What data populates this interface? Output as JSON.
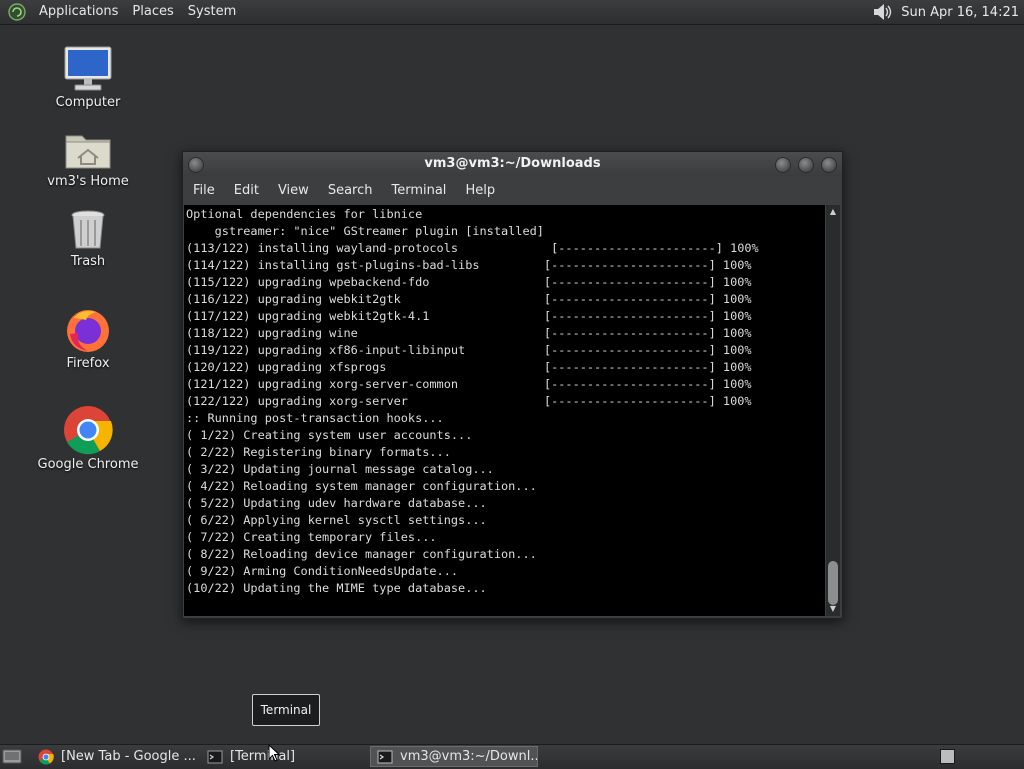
{
  "top_panel": {
    "menus": [
      "Applications",
      "Places",
      "System"
    ],
    "clock": "Sun Apr 16, 14:21",
    "icons": [
      "distro-logo-icon",
      "speaker-icon"
    ]
  },
  "desktop": {
    "icons": [
      {
        "label": "Computer",
        "icon": "computer-icon"
      },
      {
        "label": "vm3's Home",
        "icon": "home-folder-icon"
      },
      {
        "label": "Trash",
        "icon": "trash-icon"
      },
      {
        "label": "Firefox",
        "icon": "firefox-icon"
      },
      {
        "label": "Google Chrome",
        "icon": "chrome-icon"
      }
    ]
  },
  "window": {
    "title": "vm3@vm3:~/Downloads",
    "menu": [
      "File",
      "Edit",
      "View",
      "Search",
      "Terminal",
      "Help"
    ],
    "terminal_lines": [
      "Optional dependencies for libnice",
      "    gstreamer: \"nice\" GStreamer plugin [installed]",
      "(113/122) installing wayland-protocols             [----------------------] 100%",
      "(114/122) installing gst-plugins-bad-libs         [----------------------] 100%",
      "(115/122) upgrading wpebackend-fdo                [----------------------] 100%",
      "(116/122) upgrading webkit2gtk                    [----------------------] 100%",
      "(117/122) upgrading webkit2gtk-4.1                [----------------------] 100%",
      "(118/122) upgrading wine                          [----------------------] 100%",
      "(119/122) upgrading xf86-input-libinput           [----------------------] 100%",
      "(120/122) upgrading xfsprogs                      [----------------------] 100%",
      "(121/122) upgrading xorg-server-common            [----------------------] 100%",
      "(122/122) upgrading xorg-server                   [----------------------] 100%",
      ":: Running post-transaction hooks...",
      "( 1/22) Creating system user accounts...",
      "( 2/22) Registering binary formats...",
      "( 3/22) Updating journal message catalog...",
      "( 4/22) Reloading system manager configuration...",
      "( 5/22) Updating udev hardware database...",
      "( 6/22) Applying kernel sysctl settings...",
      "( 7/22) Creating temporary files...",
      "( 8/22) Reloading device manager configuration...",
      "( 9/22) Arming ConditionNeedsUpdate...",
      "(10/22) Updating the MIME type database..."
    ]
  },
  "tooltip": "Terminal",
  "taskbar": {
    "tasks": [
      {
        "label": "[New Tab - Google ...",
        "icon": "chrome-icon",
        "active": false
      },
      {
        "label": "[Terminal]",
        "icon": "terminal-icon",
        "active": false
      },
      {
        "label": "vm3@vm3:~/Downl...",
        "icon": "terminal-icon",
        "active": true
      }
    ]
  },
  "colors": {
    "desktop_bg": "#2f3133",
    "panel_bg": "#2c2e30",
    "terminal_bg": "#000000",
    "terminal_fg": "#dcdcdc"
  }
}
